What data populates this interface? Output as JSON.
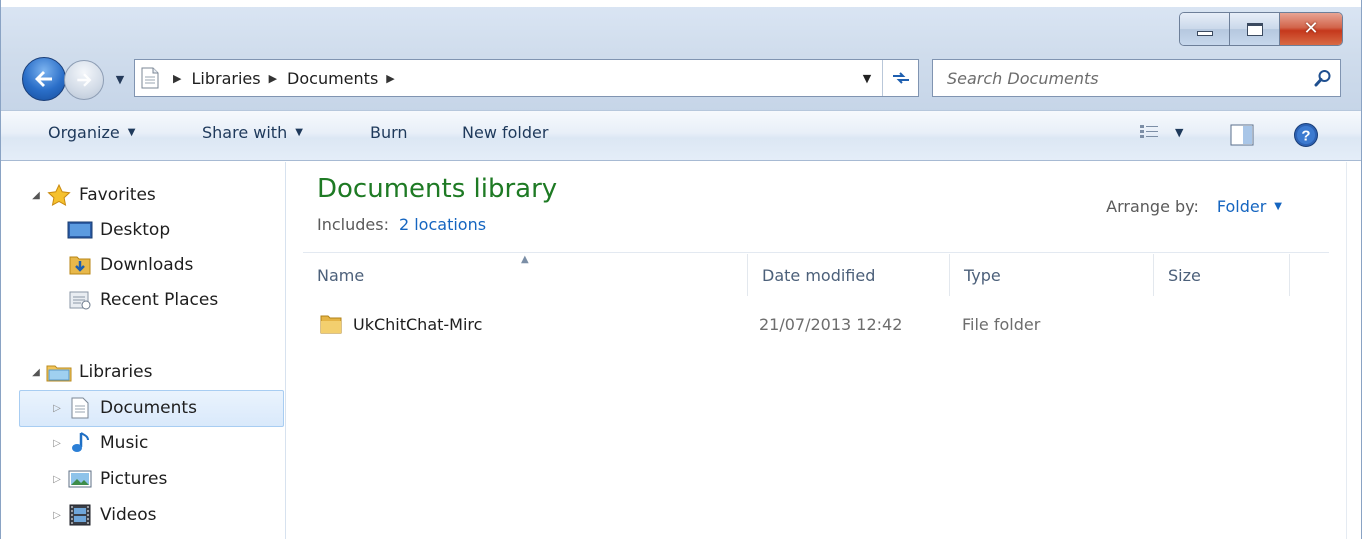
{
  "window": {
    "caption_buttons": [
      "minimize",
      "maximize",
      "close"
    ]
  },
  "address_bar": {
    "breadcrumbs": [
      "Libraries",
      "Documents"
    ]
  },
  "search": {
    "placeholder": "Search Documents"
  },
  "toolbar": {
    "organize_label": "Organize",
    "share_with_label": "Share with",
    "burn_label": "Burn",
    "new_folder_label": "New folder"
  },
  "navigation": {
    "favorites": {
      "label": "Favorites",
      "items": [
        {
          "label": "Desktop",
          "icon": "desktop-icon"
        },
        {
          "label": "Downloads",
          "icon": "downloads-icon"
        },
        {
          "label": "Recent Places",
          "icon": "recent-places-icon"
        }
      ]
    },
    "libraries": {
      "label": "Libraries",
      "items": [
        {
          "label": "Documents",
          "icon": "documents-icon",
          "selected": true
        },
        {
          "label": "Music",
          "icon": "music-icon"
        },
        {
          "label": "Pictures",
          "icon": "pictures-icon"
        },
        {
          "label": "Videos",
          "icon": "videos-icon"
        }
      ]
    }
  },
  "library": {
    "title": "Documents library",
    "includes_label": "Includes:",
    "includes_link": "2 locations",
    "arrange_by_label": "Arrange by:",
    "arrange_by_value": "Folder"
  },
  "file_list": {
    "columns": [
      "Name",
      "Date modified",
      "Type",
      "Size"
    ],
    "rows": [
      {
        "name": "UkChitChat-Mirc",
        "date_modified": "21/07/2013 12:42",
        "type": "File folder",
        "size": ""
      }
    ]
  },
  "colors": {
    "library_title": "#1e7a24",
    "link": "#1565c0",
    "selection": "#d9e9fb"
  }
}
